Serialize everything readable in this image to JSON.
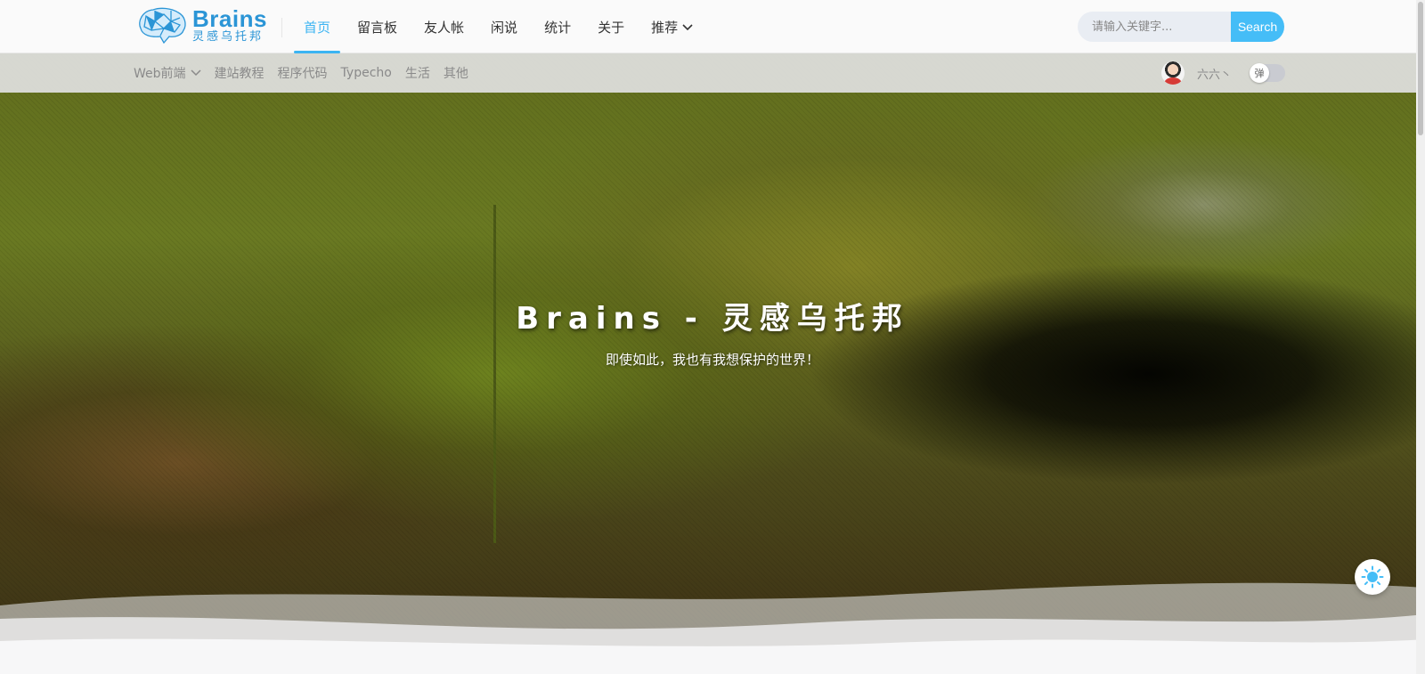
{
  "brand": {
    "title": "Brains",
    "subtitle": "灵感乌托邦",
    "color": "#2b95d6"
  },
  "nav": {
    "items": [
      {
        "label": "首页",
        "active": true
      },
      {
        "label": "留言板"
      },
      {
        "label": "友人帐"
      },
      {
        "label": "闲说"
      },
      {
        "label": "统计"
      },
      {
        "label": "关于"
      },
      {
        "label": "推荐",
        "has_dropdown": true
      }
    ],
    "accent": "#3bb4f2"
  },
  "search": {
    "placeholder": "请输入关键字...",
    "button": "Search",
    "button_color": "#45bdf7"
  },
  "subnav": {
    "items": [
      {
        "label": "Web前端",
        "has_dropdown": true
      },
      {
        "label": "建站教程"
      },
      {
        "label": "程序代码"
      },
      {
        "label": "Typecho"
      },
      {
        "label": "生活"
      },
      {
        "label": "其他"
      }
    ]
  },
  "user": {
    "name": "六六丶",
    "toggle_label": "弹",
    "toggle_on": false
  },
  "hero": {
    "title": "Brains - 灵感乌托邦",
    "subtitle": "即使如此，我也有我想保护的世界！"
  },
  "icons": {
    "logo": "brain-logo-icon",
    "dropdown": "chevron-down-icon",
    "theme": "sun-icon"
  }
}
